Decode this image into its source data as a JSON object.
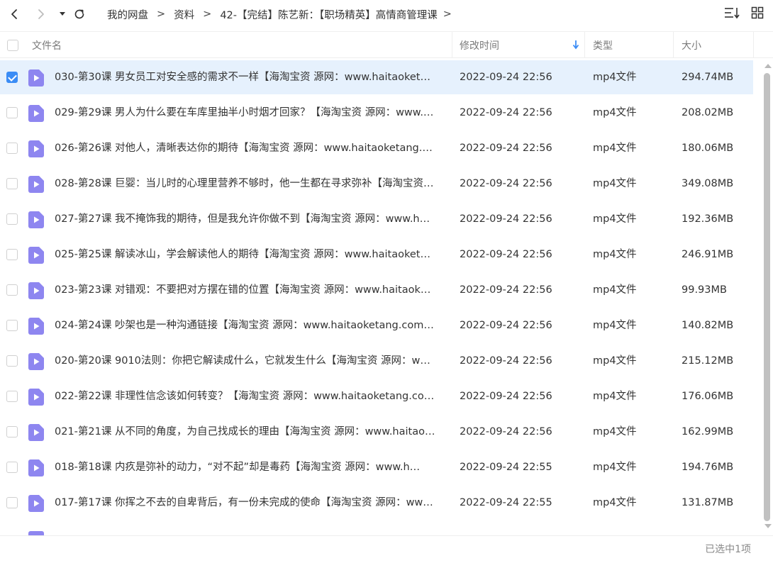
{
  "nav": {
    "back_icon": "chevron-left-icon",
    "forward_icon": "chevron-right-icon",
    "history_icon": "caret-down-icon",
    "refresh_icon": "refresh-icon"
  },
  "breadcrumb": {
    "items": [
      "我的网盘",
      "资料",
      "42-【完结】陈艺新：【职场精英】高情商管理课"
    ],
    "separator": ">",
    "trail": ">"
  },
  "view_controls": {
    "sort_icon": "sort-icon",
    "grid_icon": "grid-view-icon"
  },
  "columns": {
    "name": "文件名",
    "modified": "修改时间",
    "type": "类型",
    "size": "大小",
    "sort_indicator": "↓"
  },
  "colors": {
    "accent": "#3b8cf5",
    "selected_row": "#e6f1fd",
    "file_icon": "#8e86f0"
  },
  "files": [
    {
      "name": "030-第30课 男女员工对安全感的需求不一样【海淘宝资 源网：www.haitaoket…",
      "modified": "2022-09-24 22:56",
      "type": "mp4文件",
      "size": "294.74MB",
      "selected": true
    },
    {
      "name": "029-第29课 男人为什么要在车库里抽半小时烟才回家？【海淘宝资 源网：www.…",
      "modified": "2022-09-24 22:56",
      "type": "mp4文件",
      "size": "208.02MB",
      "selected": false
    },
    {
      "name": "026-第26课 对他人，清晰表达你的期待【海淘宝资 源网：www.haitaoketang.…",
      "modified": "2022-09-24 22:56",
      "type": "mp4文件",
      "size": "180.06MB",
      "selected": false
    },
    {
      "name": "028-第28课 巨婴：当儿时的心理里营养不够时，他一生都在寻求弥补【海淘宝资…",
      "modified": "2022-09-24 22:56",
      "type": "mp4文件",
      "size": "349.08MB",
      "selected": false
    },
    {
      "name": "027-第27课 我不掩饰我的期待，但是我允许你做不到【海淘宝资 源网：www.h…",
      "modified": "2022-09-24 22:56",
      "type": "mp4文件",
      "size": "192.36MB",
      "selected": false
    },
    {
      "name": "025-第25课 解读冰山，学会解读他人的期待【海淘宝资 源网：www.haitaoket…",
      "modified": "2022-09-24 22:56",
      "type": "mp4文件",
      "size": "246.91MB",
      "selected": false
    },
    {
      "name": "023-第23课 对错观：不要把对方摆在错的位置【海淘宝资 源网：www.haitaok…",
      "modified": "2022-09-24 22:56",
      "type": "mp4文件",
      "size": "99.93MB",
      "selected": false
    },
    {
      "name": "024-第24课 吵架也是一种沟通链接【海淘宝资 源网：www.haitaoketang.com…",
      "modified": "2022-09-24 22:56",
      "type": "mp4文件",
      "size": "140.82MB",
      "selected": false
    },
    {
      "name": "020-第20课 9010法则：你把它解读成什么，它就发生什么【海淘宝资 源网：w…",
      "modified": "2022-09-24 22:56",
      "type": "mp4文件",
      "size": "215.12MB",
      "selected": false
    },
    {
      "name": "022-第22课 非理性信念该如何转变？【海淘宝资 源网：www.haitaoketang.co…",
      "modified": "2022-09-24 22:56",
      "type": "mp4文件",
      "size": "176.06MB",
      "selected": false
    },
    {
      "name": "021-第21课 从不同的角度，为自己找成长的理由【海淘宝资 源网：www.haitao…",
      "modified": "2022-09-24 22:56",
      "type": "mp4文件",
      "size": "162.99MB",
      "selected": false
    },
    {
      "name": "018-第18课 内疚是弥补的动力，“对不起”却是毒药【海淘宝资 源网：www.h…",
      "modified": "2022-09-24 22:55",
      "type": "mp4文件",
      "size": "194.76MB",
      "selected": false
    },
    {
      "name": "017-第17课 你挥之不去的自卑背后，有一份未完成的使命【海淘宝资 源网：ww…",
      "modified": "2022-09-24 22:55",
      "type": "mp4文件",
      "size": "131.87MB",
      "selected": false
    }
  ],
  "status": {
    "selection_text": "已选中1项"
  }
}
